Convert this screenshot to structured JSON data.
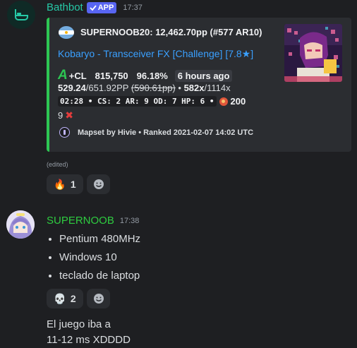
{
  "bot_message": {
    "author": "Bathbot",
    "app_badge": "APP",
    "time": "17:37",
    "edited_label": "(edited)",
    "embed": {
      "accent_color": "#2dc653",
      "author_text": "SUPERNOOB20: 12,462.70pp (#577 AR10)",
      "flag_icon": "argentina-flag-icon",
      "title": "Kobaryo - Transceiver FX [Challenge] [7.8★]",
      "grade": "A",
      "mods": "+CL",
      "score": "815,750",
      "accuracy": "96.18%",
      "time_ago": "6 hours ago",
      "pp": "529.24",
      "pp_max": "/651.92PP",
      "pp_fc": "(590.61pp)",
      "combo": "582x",
      "max_combo": "/1114x",
      "map_stats": "02:28 • CS: 2 AR: 9 OD: 7 HP: 6 •",
      "bpm": "200",
      "misses": "9",
      "footer": "Mapset by Hivie • Ranked 2021-02-07 14:02 UTC"
    },
    "reactions": [
      {
        "emoji": "🔥",
        "name": "fire-emoji",
        "count": "1"
      }
    ]
  },
  "user_message": {
    "author": "SUPERNOOB",
    "author_color": "#2ecc40",
    "time": "17:38",
    "bullets": [
      "Pentium 480MHz",
      "Windows 10",
      "teclado de laptop"
    ],
    "reactions": [
      {
        "emoji": "💀",
        "name": "skull-emoji",
        "count": "2"
      }
    ],
    "text_line1": "El juego iba a",
    "text_line2": "11-12 ms XDDDD"
  }
}
